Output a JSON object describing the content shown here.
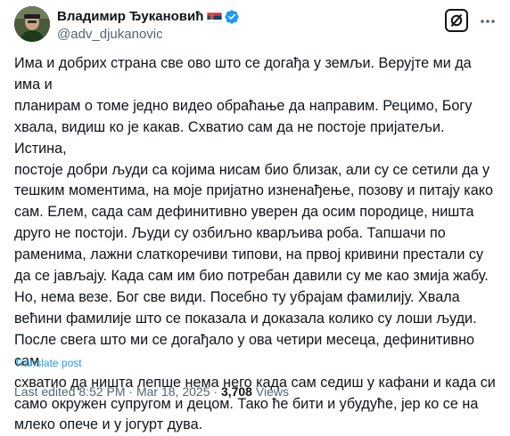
{
  "author": {
    "display_name": "Владимир Ђукановић",
    "handle": "@adv_djukanovic",
    "flag_icon": "serbia-flag-icon",
    "verified_icon": "verified-badge-icon",
    "verified_color": "#1d9bf0"
  },
  "header_actions": {
    "grok_icon": "grok-icon",
    "more_icon": "more-horizontal-icon"
  },
  "tweet": {
    "text_lines": [
      "Има и добрих страна све ово што се догађа у земљи. Верујте ми да има и",
      "планирам о томе једно видео обраћање да направим. Рецимо, Богу",
      "хвала, видиш ко је какав. Схватио сам да не постоје пријатељи. Истина,",
      "постоје добри људи са којима нисам био близак, али су се сетили да у",
      "тешким моментима, на моје пријатно изненађење, позову и питају како",
      "сам. Елем, сада сам дефинитивно уверен да осим породице, ништа",
      "друго не постоји. Људи су озбиљно кварљива роба. Тапшачи по",
      "раменима, лажни слаткоречиви типови, на првој кривини престали су",
      "да се јављају. Када сам им био потребан давили су ме као змија жабу.",
      "Но, нема везе. Бог све види. Посебно ту убрајам фамилију. Хвала",
      "већини фамилије што се показала и доказала колико су лоши људи.",
      "После свега што ми се догађало у ова четири месеца, дефинитивно сам",
      "схватио да ништа лепше нема него када сам седиш у кафани и када си",
      "само окружен супругом и децом. Тако ће бити и убудуће, јер ко се на",
      "млеко опече и у јогурт дува."
    ],
    "translate_label": "Translate post"
  },
  "meta": {
    "edited_label": "Last edited",
    "time": "8:52 PM",
    "separator": "·",
    "date": "Mar 18, 2025",
    "views_count": "3,708",
    "views_label": "Views"
  },
  "colors": {
    "text_primary": "#0f1419",
    "text_secondary": "#536471",
    "accent": "#1d9bf0"
  }
}
